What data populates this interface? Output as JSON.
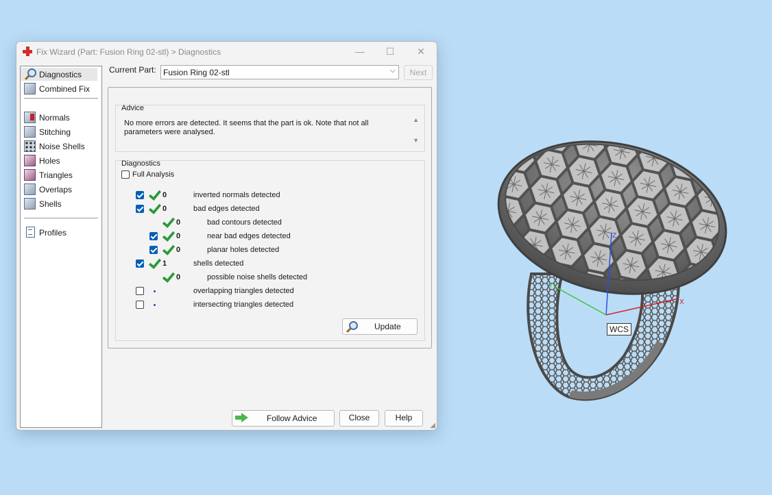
{
  "window": {
    "title": "Fix Wizard (Part: Fusion Ring 02-stl) > Diagnostics",
    "minimize": "—",
    "maximize": "☐",
    "close": "✕"
  },
  "sidebar": {
    "items": [
      {
        "label": "Diagnostics",
        "icon": "magnifier-icon",
        "selected": true
      },
      {
        "label": "Combined Fix",
        "icon": "combined-fix-icon"
      },
      {
        "label": "Normals",
        "icon": "normals-icon"
      },
      {
        "label": "Stitching",
        "icon": "stitching-icon"
      },
      {
        "label": "Noise Shells",
        "icon": "noise-shells-icon"
      },
      {
        "label": "Holes",
        "icon": "holes-icon"
      },
      {
        "label": "Triangles",
        "icon": "triangles-icon"
      },
      {
        "label": "Overlaps",
        "icon": "overlaps-icon"
      },
      {
        "label": "Shells",
        "icon": "shells-icon"
      },
      {
        "label": "Profiles",
        "icon": "profiles-icon"
      }
    ]
  },
  "current_part": {
    "label": "Current Part:",
    "value": "Fusion Ring 02-stl",
    "next": "Next"
  },
  "advice": {
    "title": "Advice",
    "text": "No more errors are detected. It seems that the part is ok. Note that not all parameters were analysed.",
    "scroll_up": "▲",
    "scroll_down": "▼"
  },
  "diagnostics": {
    "title": "Diagnostics",
    "full_analysis": "Full Analysis",
    "full_analysis_checked": false,
    "rows": [
      {
        "checkbox": true,
        "status": "ok",
        "count": "0",
        "text": "inverted normals detected"
      },
      {
        "checkbox": true,
        "status": "ok",
        "count": "0",
        "text": "bad edges detected"
      },
      {
        "checkbox": null,
        "status": "ok",
        "count": "0",
        "text": "bad contours detected"
      },
      {
        "checkbox": true,
        "status": "ok",
        "count": "0",
        "text": "near bad edges detected"
      },
      {
        "checkbox": true,
        "status": "ok",
        "count": "0",
        "text": "planar holes detected"
      },
      {
        "checkbox": true,
        "status": "ok",
        "count": "1",
        "text": "shells detected"
      },
      {
        "checkbox": null,
        "status": "ok",
        "count": "0",
        "text": "possible noise shells detected"
      },
      {
        "checkbox": false,
        "status": "none",
        "count": "",
        "text": "overlapping triangles detected"
      },
      {
        "checkbox": false,
        "status": "none",
        "count": "",
        "text": "intersecting triangles detected"
      }
    ],
    "update": "Update"
  },
  "footer": {
    "follow_advice": "Follow Advice",
    "close": "Close",
    "help": "Help"
  },
  "viewport": {
    "wcs_label": "WCS",
    "axis_x": "X",
    "axis_y": "Y",
    "axis_z": "Z"
  },
  "colors": {
    "background": "#badcf6",
    "checkbox_on": "#005fb8",
    "tick": "#2e9a3a",
    "axis_x": "#d42020",
    "axis_y": "#3cc43c",
    "axis_z": "#2a4fe0",
    "ring": "#6e6e6e"
  }
}
